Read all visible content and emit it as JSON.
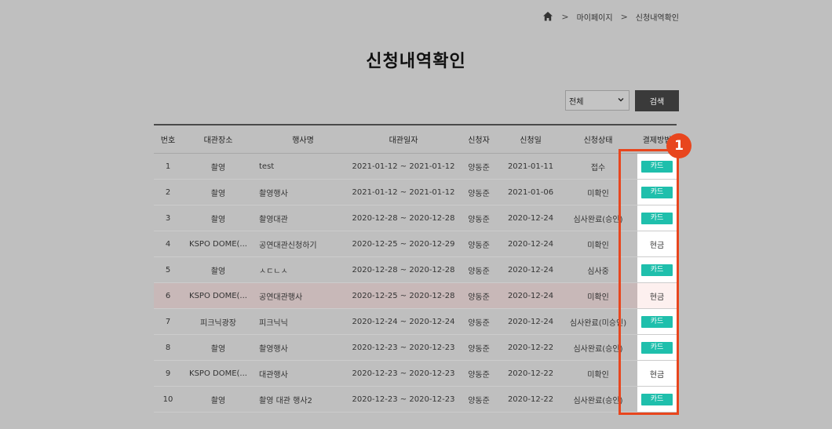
{
  "breadcrumb": {
    "items": [
      "마이페이지",
      "신청내역확인"
    ]
  },
  "page_title": "신청내역확인",
  "filter": {
    "selected": "전체"
  },
  "search_button": "검색",
  "table": {
    "headers": [
      "번호",
      "대관장소",
      "행사명",
      "대관일자",
      "신청자",
      "신청일",
      "신청상태",
      "결제방법"
    ],
    "rows": [
      {
        "no": "1",
        "place": "촬영",
        "event": "test",
        "period": "2021-01-12 ~ 2021-01-12",
        "applicant": "양동준",
        "date": "2021-01-11",
        "status": "접수",
        "payment": "카드"
      },
      {
        "no": "2",
        "place": "촬영",
        "event": "촬영행사",
        "period": "2021-01-12 ~ 2021-01-12",
        "applicant": "양동준",
        "date": "2021-01-06",
        "status": "미확인",
        "payment": "카드"
      },
      {
        "no": "3",
        "place": "촬영",
        "event": "촬영대관",
        "period": "2020-12-28 ~ 2020-12-28",
        "applicant": "양동준",
        "date": "2020-12-24",
        "status": "심사완료(승인)",
        "payment": "카드"
      },
      {
        "no": "4",
        "place": "KSPO DOME(...",
        "event": "공연대관신청하기",
        "period": "2020-12-25 ~ 2020-12-29",
        "applicant": "양동준",
        "date": "2020-12-24",
        "status": "미확인",
        "payment": "현금"
      },
      {
        "no": "5",
        "place": "촬영",
        "event": "ㅅㄷㄴㅅ",
        "period": "2020-12-28 ~ 2020-12-28",
        "applicant": "양동준",
        "date": "2020-12-24",
        "status": "심사중",
        "payment": "카드"
      },
      {
        "no": "6",
        "place": "KSPO DOME(...",
        "event": "공연대관행사",
        "period": "2020-12-25 ~ 2020-12-28",
        "applicant": "양동준",
        "date": "2020-12-24",
        "status": "미확인",
        "payment": "현금"
      },
      {
        "no": "7",
        "place": "피크닉광장",
        "event": "피크닉닉",
        "period": "2020-12-24 ~ 2020-12-24",
        "applicant": "양동준",
        "date": "2020-12-24",
        "status": "심사완료(미승인)",
        "payment": "카드"
      },
      {
        "no": "8",
        "place": "촬영",
        "event": "촬영행사",
        "period": "2020-12-23 ~ 2020-12-23",
        "applicant": "양동준",
        "date": "2020-12-22",
        "status": "심사완료(승인)",
        "payment": "카드"
      },
      {
        "no": "9",
        "place": "KSPO DOME(...",
        "event": "대관행사",
        "period": "2020-12-23 ~ 2020-12-23",
        "applicant": "양동준",
        "date": "2020-12-22",
        "status": "미확인",
        "payment": "현금"
      },
      {
        "no": "10",
        "place": "촬영",
        "event": "촬영 대관 행사2",
        "period": "2020-12-23 ~ 2020-12-23",
        "applicant": "양동준",
        "date": "2020-12-22",
        "status": "심사완료(승인)",
        "payment": "카드"
      }
    ]
  },
  "callout": {
    "number": "1"
  },
  "colors": {
    "badge": "#1fbfac",
    "callout": "#e8461e",
    "highlight_row": "#c8b8b8"
  },
  "icons": {
    "home": "home-icon",
    "separator": "chevron-right-icon",
    "select": "chevron-down-icon"
  }
}
